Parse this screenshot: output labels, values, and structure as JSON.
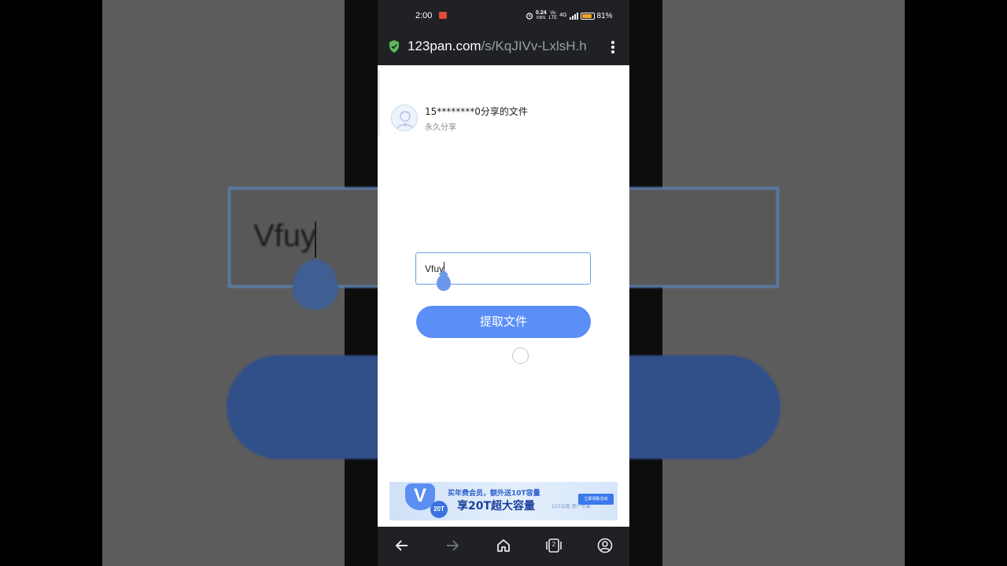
{
  "background": {
    "input_value": "Vfuy"
  },
  "status_bar": {
    "time": "2:00",
    "speed_value": "0.24",
    "speed_unit": "KB/S",
    "network_top": "Vo",
    "network_bottom": "LTE",
    "network_type": "4G",
    "battery_percent": "81%",
    "battery_level": 0.81
  },
  "url_bar": {
    "domain": "123pan.com",
    "path": "/s/KqJIVv-LxlsH.h"
  },
  "share": {
    "owner_title": "15********0分享的文件",
    "subtitle": "永久分享"
  },
  "form": {
    "code_value": "Vfuy",
    "extract_button": "提取文件"
  },
  "ad": {
    "badge": "20T",
    "line1": "买年费会员，额外送10T容量",
    "line2": "享20T超大容量",
    "sub": "123云盘 用户专属",
    "cta": "立即领取活动"
  },
  "colors": {
    "accent": "#5b8ef7",
    "secure_icon": "#5cb85c",
    "chrome_bg": "#202124"
  },
  "nav": {
    "tab_count": "2"
  }
}
